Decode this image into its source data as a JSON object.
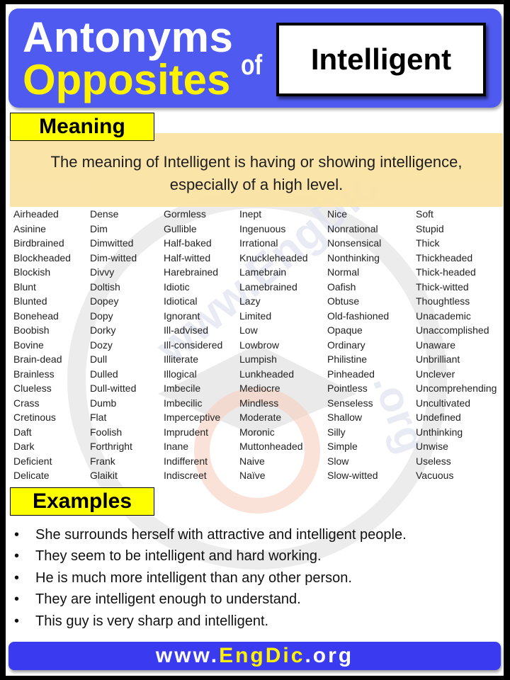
{
  "header": {
    "title_line1": "Antonyms",
    "title_line2": "Opposites",
    "connector": "of",
    "word": "Intelligent"
  },
  "meaning": {
    "label": "Meaning",
    "text": "The meaning of Intelligent is having or showing intelligence, especially of a high level."
  },
  "antonyms": {
    "columns": [
      [
        "Airheaded",
        "Asinine",
        "Birdbrained",
        "Blockheaded",
        "Blockish",
        "Blunt",
        "Blunted",
        "Bonehead",
        "Boobish",
        "Bovine",
        "Brain-dead",
        "Brainless",
        "Clueless",
        "Crass",
        "Cretinous",
        "Daft",
        "Dark",
        "Deficient",
        "Delicate"
      ],
      [
        "Dense",
        "Dim",
        "Dimwitted",
        "Dim-witted",
        "Divvy",
        "Doltish",
        "Dopey",
        "Dopy",
        "Dorky",
        "Dozy",
        "Dull",
        "Dulled",
        "Dull-witted",
        "Dumb",
        "Flat",
        "Foolish",
        "Forthright",
        "Frank",
        "Glaikit"
      ],
      [
        "Gormless",
        "Gullible",
        "Half-baked",
        "Half-witted",
        "Harebrained",
        "Idiotic",
        "Idiotical",
        "Ignorant",
        "Ill-advised",
        "Ill-considered",
        "Illiterate",
        "Illogical",
        "Imbecile",
        "Imbecilic",
        "Imperceptive",
        "Imprudent",
        "Inane",
        "Indifferent",
        "Indiscreet"
      ],
      [
        "Inept",
        "Ingenuous",
        "Irrational",
        "Knuckleheaded",
        "Lamebrain",
        "Lamebrained",
        "Lazy",
        "Limited",
        "Low",
        "Lowbrow",
        "Lumpish",
        "Lunkheaded",
        "Mediocre",
        "Mindless",
        "Moderate",
        "Moronic",
        "Muttonheaded",
        "Naive",
        "Naïve"
      ],
      [
        "Nice",
        "Nonrational",
        "Nonsensical",
        "Nonthinking",
        "Normal",
        "Oafish",
        "Obtuse",
        "Old-fashioned",
        "Opaque",
        "Ordinary",
        "Philistine",
        "Pinheaded",
        "Pointless",
        "Senseless",
        "Shallow",
        "Silly",
        "Simple",
        "Slow",
        "Slow-witted"
      ],
      [
        "Soft",
        "Stupid",
        "Thick",
        "Thickheaded",
        "Thick-headed",
        "Thick-witted",
        "Thoughtless",
        "Unacademic",
        "Unaccomplished",
        "Unaware",
        "Unbrilliant",
        "Unclever",
        "Uncomprehending",
        "Uncultivated",
        "Undefined",
        "Unthinking",
        "Unwise",
        "Useless",
        "Vacuous"
      ]
    ]
  },
  "examples": {
    "label": "Examples",
    "items": [
      "She surrounds herself with attractive and intelligent people.",
      "They seem to be intelligent and hard working.",
      "He is much more intelligent than any other person.",
      "They are intelligent enough to understand.",
      "This guy is very sharp and intelligent."
    ]
  },
  "footer": {
    "prefix": "www.",
    "brand": "EngDic",
    "suffix": ".org"
  },
  "watermark": {
    "text_top": "www.EngDic",
    "text_side": ".org",
    "icon": "graduation-cap-e-logo"
  },
  "colors": {
    "header_bg": "#4f5bf0",
    "title_yellow": "#fff200",
    "label_yellow": "#ffff00",
    "meaning_bg": "#fbe3a4",
    "footer_bg": "#3a3af0"
  }
}
